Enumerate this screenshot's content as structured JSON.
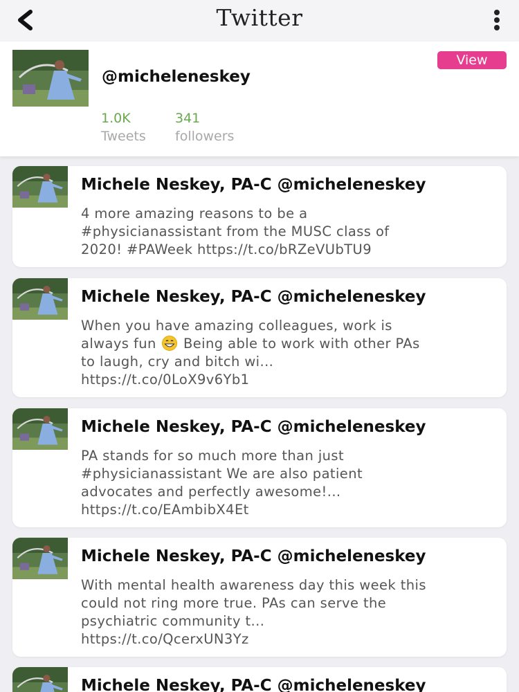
{
  "header": {
    "title": "Twitter"
  },
  "profile": {
    "handle": "@micheleneskey",
    "view_label": "View",
    "tweets_count": "1.0K",
    "tweets_label": "Tweets",
    "followers_count": "341",
    "followers_label": "followers"
  },
  "colors": {
    "accent_pink": "#e63d8e",
    "stat_green": "#6aa84f",
    "background": "#efeef2"
  },
  "tweets": [
    {
      "author": "Michele Neskey, PA-C @micheleneskey",
      "lines": [
        "4 more amazing reasons to be a",
        "#physicianassistant from the MUSC class of",
        "2020! #PAWeek https://t.co/bRZeVUbTU9"
      ]
    },
    {
      "author": "Michele Neskey, PA-C @micheleneskey",
      "lines": [
        "When you have amazing colleagues, work is",
        "always fun",
        "Being able to work with other PAs",
        "to laugh, cry and bitch wi...",
        "https://t.co/0LoX9v6Yb1"
      ]
    },
    {
      "author": "Michele Neskey, PA-C @micheleneskey",
      "lines": [
        "PA stands for so much more than just",
        "#physicianassistant We are also patient",
        "advocates and perfectly awesome!...",
        "https://t.co/EAmbibX4Et"
      ]
    },
    {
      "author": "Michele Neskey, PA-C @micheleneskey",
      "lines": [
        "With mental health awareness day this week this",
        "could not ring more true. PAs can serve the",
        "psychiatric community t...",
        "https://t.co/QcerxUN3Yz"
      ]
    },
    {
      "author": "Michele Neskey, PA-C @micheleneskey"
    }
  ]
}
